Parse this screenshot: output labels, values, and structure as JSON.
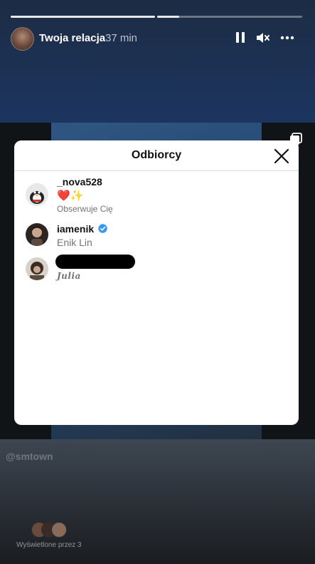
{
  "story": {
    "title": "Twoja relacja",
    "time": "37 min",
    "mention": "@smtown",
    "viewers_label": "Wyświetlone przez 3",
    "progress_segment_2": 0.15
  },
  "icons": {
    "pause": "pause-icon",
    "mute": "mute-icon",
    "more": "more-icon",
    "square": "square-stack-icon"
  },
  "modal": {
    "title": "Odbiorcy",
    "recipients": [
      {
        "username": "_nova528",
        "emoji": "❤️✨",
        "subtitle": "Obserwuje Cię"
      },
      {
        "username": "iamenik",
        "verified": true,
        "subtitle": "Enik Lin"
      },
      {
        "username": "",
        "subtitle": "Julia"
      }
    ]
  },
  "colors": {
    "verified_blue": "#3897f0",
    "modal_bg": "#ffffff",
    "secondary_text": "#737373"
  }
}
